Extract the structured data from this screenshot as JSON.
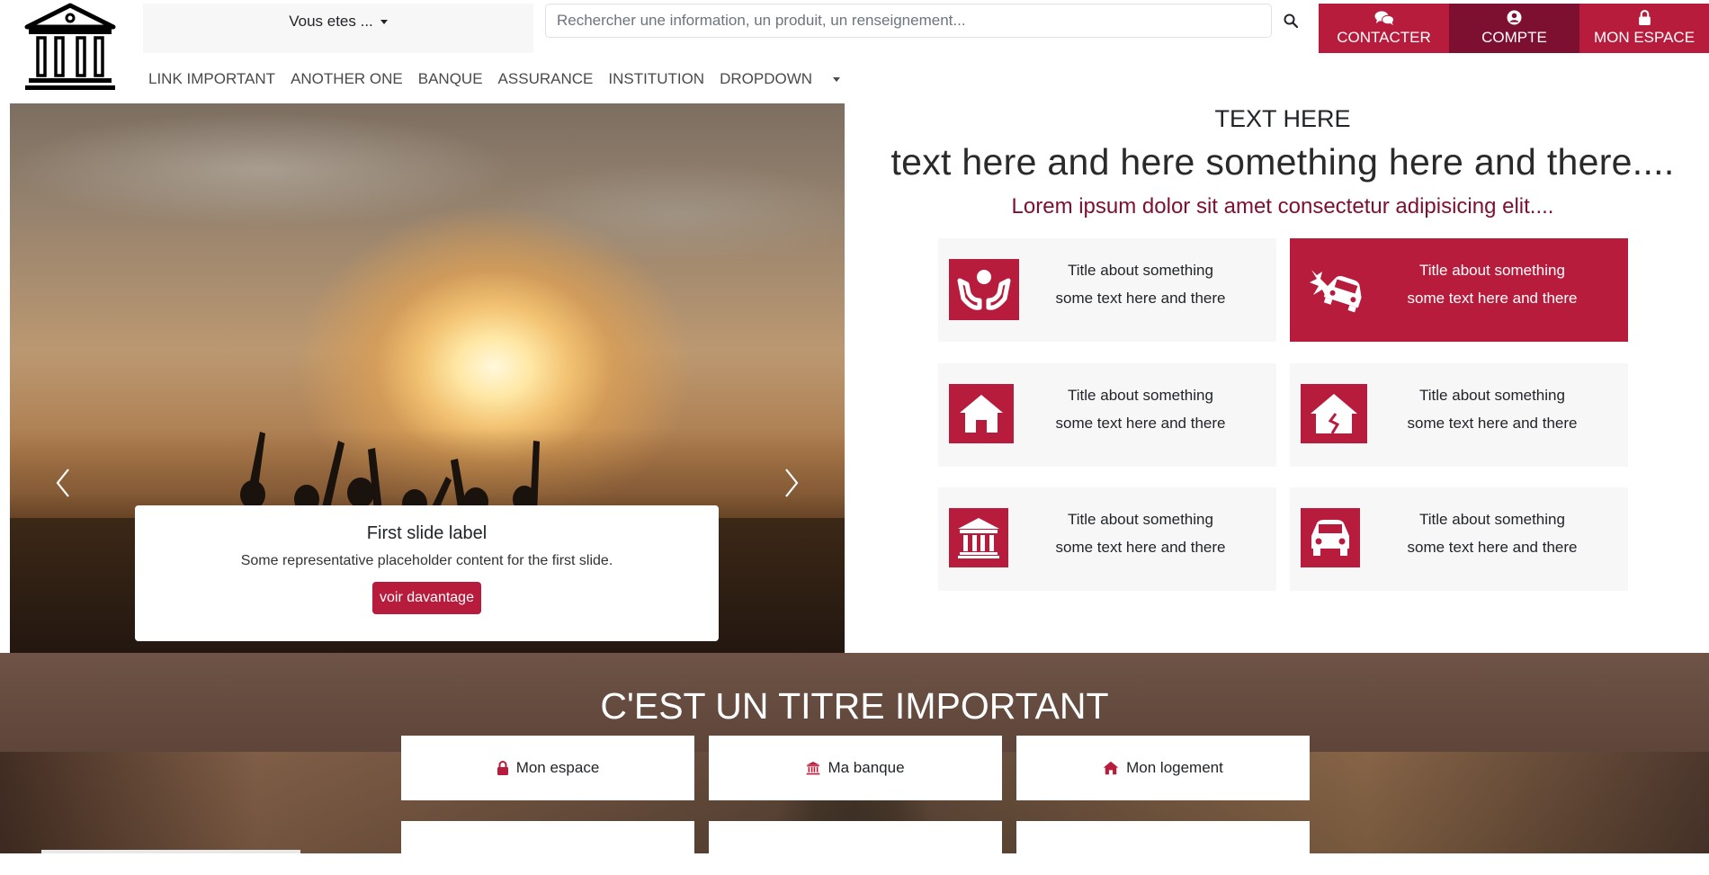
{
  "header": {
    "vous_etes": "Vous etes ...",
    "search_placeholder": "Rechercher une information, un produit, un renseignement...",
    "buttons": [
      {
        "label": "CONTACTER",
        "icon": "chat-icon"
      },
      {
        "label": "COMPTE",
        "icon": "user-icon"
      },
      {
        "label": "MON ESPACE",
        "icon": "lock-icon"
      }
    ]
  },
  "nav": {
    "items": [
      "LINK IMPORTANT",
      "ANOTHER ONE",
      "BANQUE",
      "ASSURANCE",
      "INSTITUTION"
    ],
    "dropdown": "DROPDOWN"
  },
  "carousel": {
    "caption_title": "First slide label",
    "caption_text": "Some representative placeholder content for the first slide.",
    "button": "voir davantage"
  },
  "intro": {
    "title": "TEXT HERE",
    "subtitle": "text here and here something here and there....",
    "lead": "Lorem ipsum dolor sit amet consectetur adipisicing elit...."
  },
  "cards": [
    {
      "title": "Title about something",
      "text": "some text here and there",
      "icon": "hands-care-icon",
      "active": false
    },
    {
      "title": "Title about something",
      "text": "some text here and there",
      "icon": "car-crash-icon",
      "active": true
    },
    {
      "title": "Title about something",
      "text": "some text here and there",
      "icon": "house-icon",
      "active": false
    },
    {
      "title": "Title about something",
      "text": "some text here and there",
      "icon": "house-damage-icon",
      "active": false
    },
    {
      "title": "Title about something",
      "text": "some text here and there",
      "icon": "bank-icon",
      "active": false
    },
    {
      "title": "Title about something",
      "text": "some text here and there",
      "icon": "car-icon",
      "active": false
    }
  ],
  "band": {
    "title": "C'EST UN TITRE IMPORTANT",
    "tiles": [
      {
        "label": "Mon espace",
        "icon": "lock-icon"
      },
      {
        "label": "Ma banque",
        "icon": "bank-icon"
      },
      {
        "label": "Mon logement",
        "icon": "house-icon"
      }
    ]
  },
  "colors": {
    "accent": "#b81c3c",
    "accent_dark": "#7d0f30",
    "lead_text": "#7d1030"
  }
}
